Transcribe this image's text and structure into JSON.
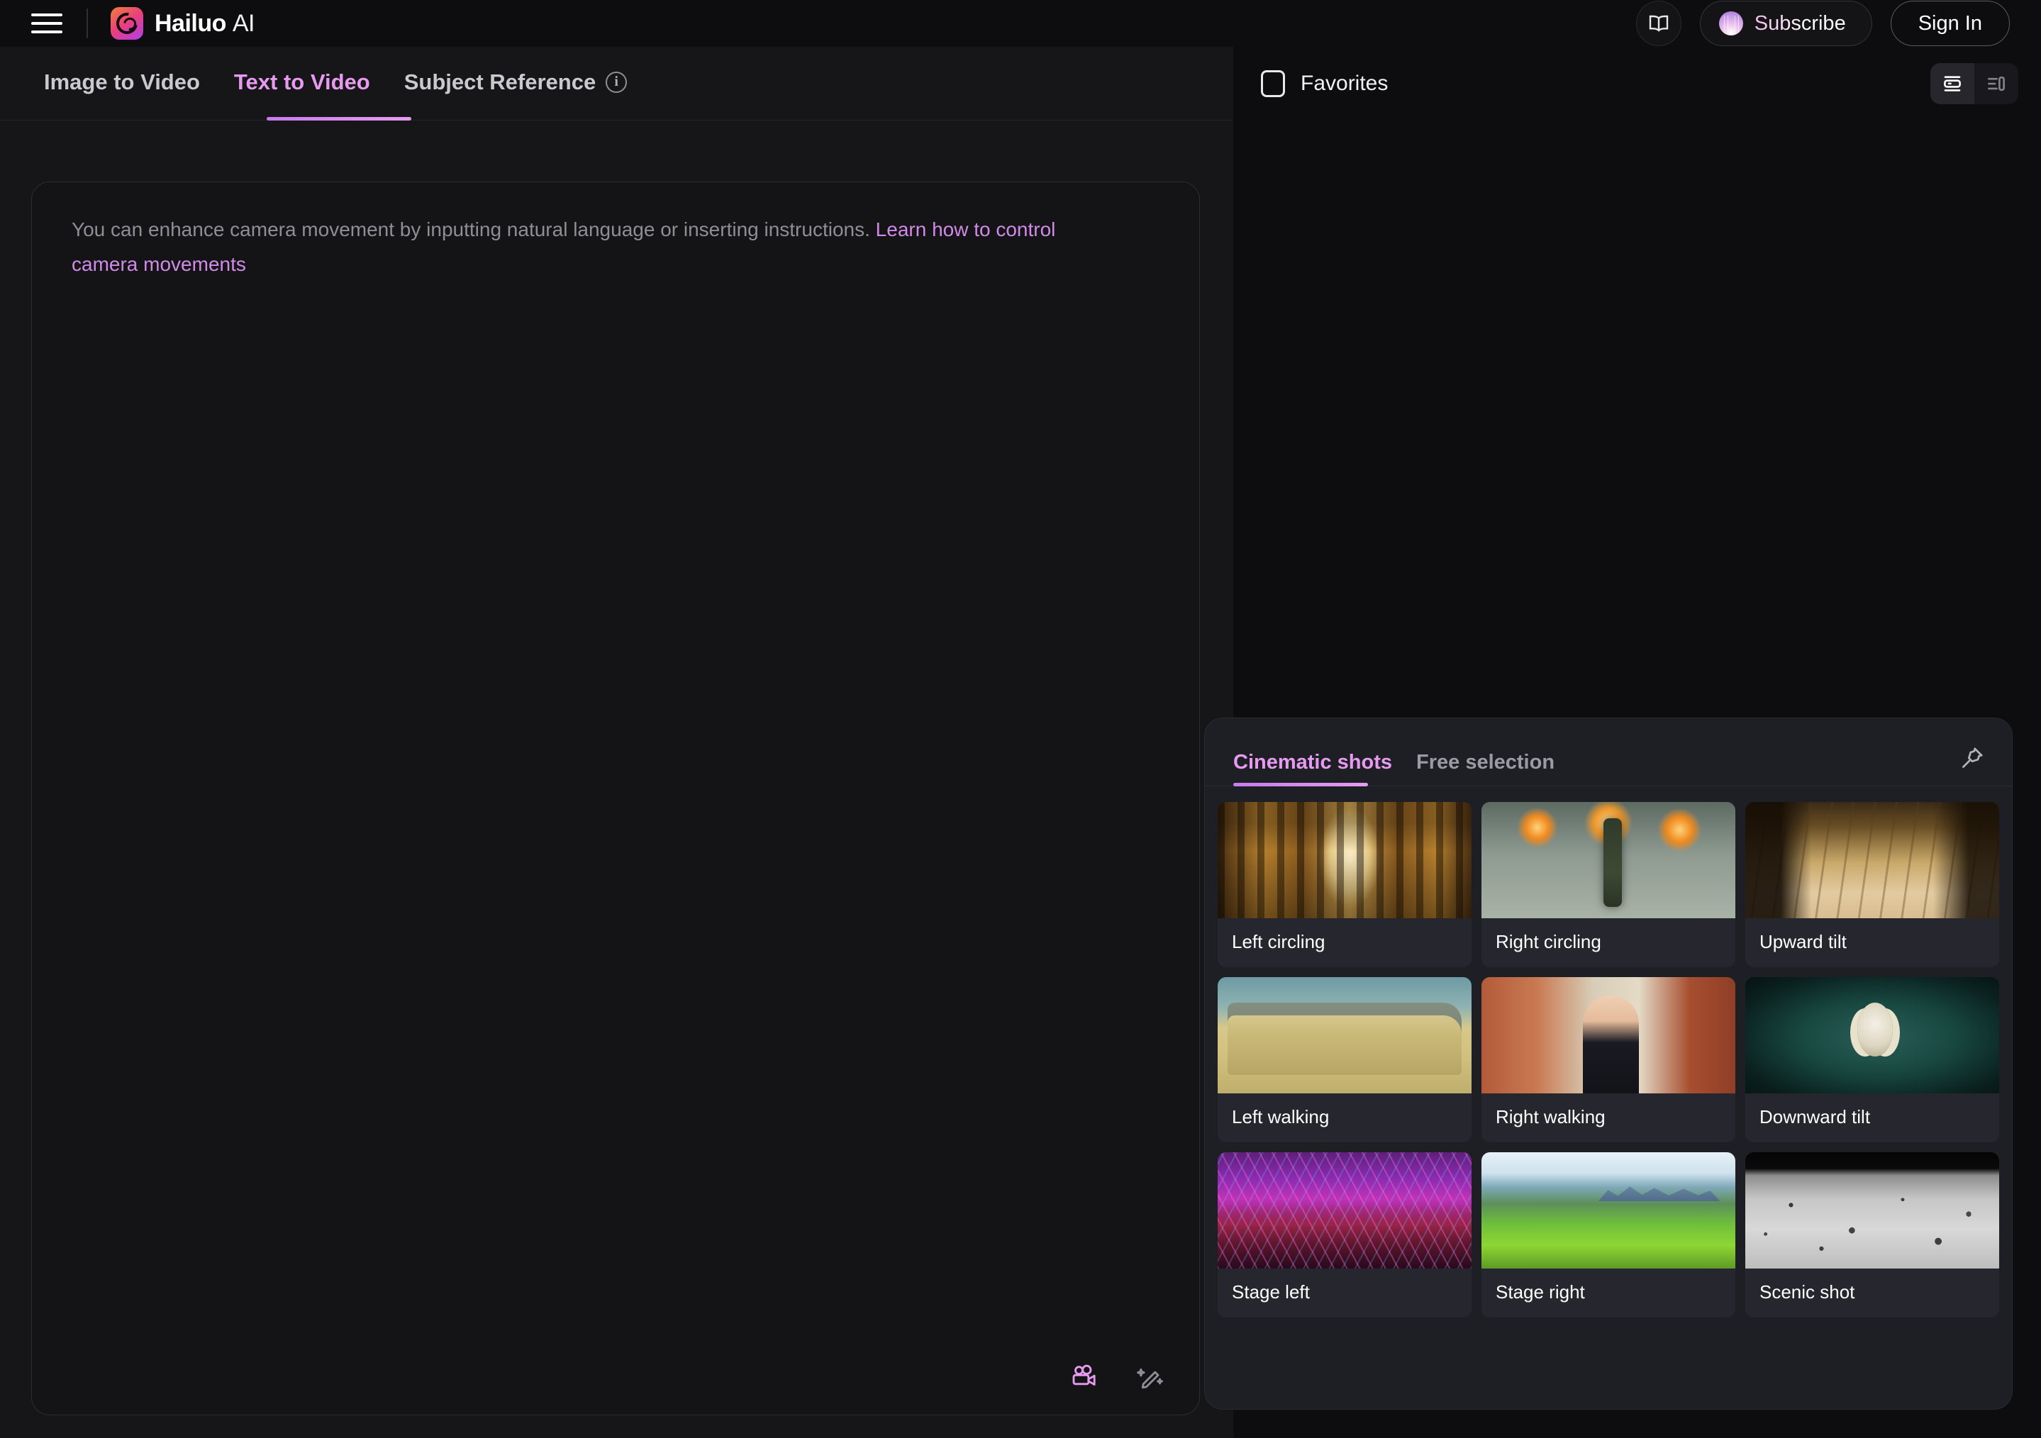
{
  "topbar": {
    "menu_icon": "hamburger-menu-icon",
    "brand_name": "Hailuo",
    "brand_suffix": "AI",
    "docs_icon": "book-icon",
    "subscribe_label": "Subscribe",
    "subscribe_icon": "shell-icon",
    "signin_label": "Sign In"
  },
  "tabs": {
    "items": [
      {
        "label": "Image to Video",
        "active": false
      },
      {
        "label": "Text to Video",
        "active": true
      },
      {
        "label": "Subject Reference",
        "active": false,
        "info_icon": "info-icon"
      }
    ]
  },
  "prompt": {
    "hint_text": "You can enhance camera movement by inputting natural language or inserting instructions. ",
    "hint_link": "Learn how to control camera movements",
    "placeholder": "",
    "value": "",
    "tools": [
      {
        "icon": "film-camera-icon",
        "name": "camera-movement-button",
        "accent": "#e79bf0"
      },
      {
        "icon": "magic-wand-icon",
        "name": "prompt-enhance-button",
        "accent": "#8e8e96"
      }
    ]
  },
  "right": {
    "favorites_label": "Favorites",
    "favorites_checked": false,
    "view_modes": [
      {
        "name": "card-view",
        "icon": "card-view-icon",
        "active": true
      },
      {
        "name": "list-view",
        "icon": "list-view-icon",
        "active": false
      }
    ]
  },
  "shots_panel": {
    "tabs": [
      {
        "label": "Cinematic shots",
        "active": true
      },
      {
        "label": "Free selection",
        "active": false
      }
    ],
    "pin_icon": "pin-icon",
    "items": [
      {
        "label": "Left circling",
        "thumb": "th-gallery"
      },
      {
        "label": "Right circling",
        "thumb": "th-war"
      },
      {
        "label": "Upward tilt",
        "thumb": "th-street"
      },
      {
        "label": "Left walking",
        "thumb": "th-car"
      },
      {
        "label": "Right walking",
        "thumb": "th-woman"
      },
      {
        "label": "Downward tilt",
        "thumb": "th-clown"
      },
      {
        "label": "Stage left",
        "thumb": "th-stage"
      },
      {
        "label": "Stage right",
        "thumb": "th-field"
      },
      {
        "label": "Scenic shot",
        "thumb": "th-moon"
      }
    ]
  },
  "colors": {
    "accent": "#e79bf0",
    "page_bg": "#0d0d0f",
    "left_bg": "#161618",
    "panel_bg": "#1e1f25",
    "card_bg": "#26272e"
  }
}
